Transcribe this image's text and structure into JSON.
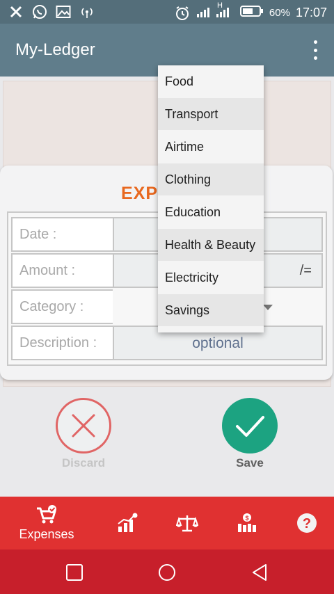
{
  "status_bar": {
    "battery_percent": "60%",
    "time": "17:07",
    "signal_letter": "H"
  },
  "app_bar": {
    "title": "My-Ledger"
  },
  "dialog": {
    "title": "EXP",
    "fields": {
      "date_label": "Date :",
      "amount_label": "Amount :",
      "amount_suffix": "/=",
      "category_label": "Category :",
      "description_label": "Description :",
      "description_placeholder": "optional"
    }
  },
  "category_menu": {
    "items": [
      "Food",
      "Transport",
      "Airtime",
      "Clothing",
      "Education",
      "Health & Beauty",
      "Electricity",
      "Savings"
    ]
  },
  "actions": {
    "discard_label": "Discard",
    "save_label": "Save"
  },
  "tabs": {
    "expenses_label": "Expenses",
    "icons": [
      "expenses-cart",
      "stats-chart",
      "balance-scale",
      "savings-bars",
      "help"
    ]
  },
  "colors": {
    "app_bar": "#607d8b",
    "dialog_title": "#e8681f",
    "save": "#1ca381",
    "discard": "#e06565",
    "tab_bar": "#e03131",
    "nav_bar": "#c71f2b"
  }
}
